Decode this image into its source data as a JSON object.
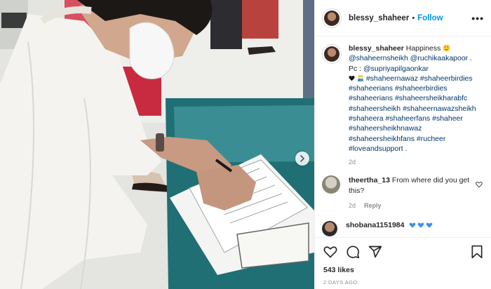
{
  "post": {
    "username": "blessy_shaheer",
    "follow_label": "Follow",
    "separator": "•",
    "more_label": "•••"
  },
  "caption": {
    "username": "blessy_shaheer",
    "line1_text": "Happiness",
    "mention1": "@shaheernsheikh",
    "mention2": "@ruchikaakapoor",
    "period": ".",
    "credit_prefix": "Pc :",
    "credit_mention": "@supriyapilgaonkar",
    "hashtags": [
      "#shaheernawaz",
      "#shaheerbirdies",
      "#shaheerians",
      "#shaheerbirdies",
      "#shaheerians",
      "#shaheersheikharabfc",
      "#shaheersheikh",
      "#shaheernawazsheikh",
      "#shaheera",
      "#shaheerfans",
      "#shaheer",
      "#shaheersheikhnawaz",
      "#shaheersheikhfans",
      "#rucheer",
      "#loveandsupport"
    ],
    "end": ".",
    "time": "2d"
  },
  "comments": [
    {
      "username": "theertha_13",
      "text": "From where did you get this?",
      "time": "2d",
      "reply_label": "Reply"
    },
    {
      "username": "shobana1151984"
    }
  ],
  "actions": {
    "icons": [
      "heart-icon",
      "comment-icon",
      "share-icon",
      "bookmark-icon"
    ]
  },
  "likes": "543 likes",
  "posted": "2 DAYS AGO",
  "colors": {
    "link": "#0095f6",
    "hashtag": "#00376b",
    "muted": "#8e8e8e"
  }
}
